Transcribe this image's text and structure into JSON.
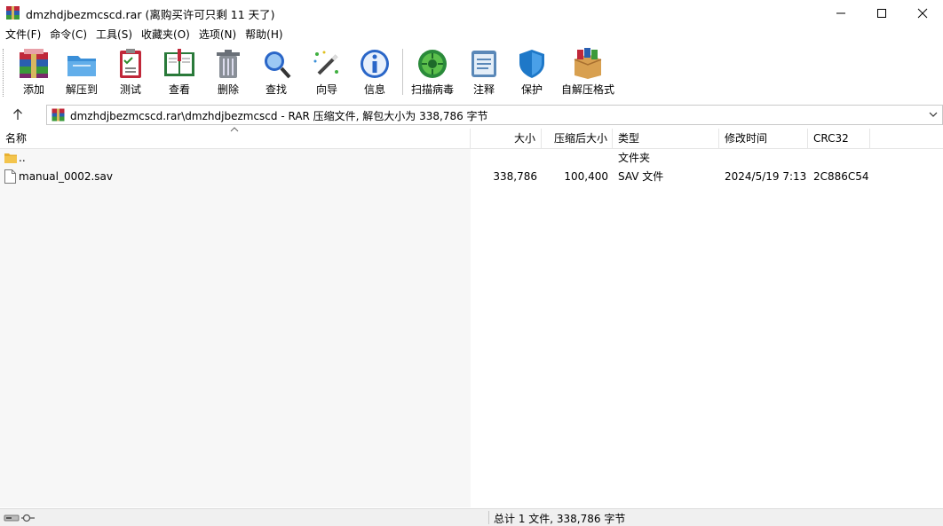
{
  "window": {
    "title": "dmzhdjbezmcscd.rar (离购买许可只剩 11 天了)"
  },
  "menu": {
    "items": [
      "文件(F)",
      "命令(C)",
      "工具(S)",
      "收藏夹(O)",
      "选项(N)",
      "帮助(H)"
    ]
  },
  "toolbar": {
    "add": "添加",
    "extract": "解压到",
    "test": "测试",
    "view": "查看",
    "delete": "删除",
    "find": "查找",
    "wizard": "向导",
    "info": "信息",
    "scan": "扫描病毒",
    "comment": "注释",
    "protect": "保护",
    "sfx": "自解压格式"
  },
  "address": {
    "path": "dmzhdjbezmcscd.rar\\dmzhdjbezmcscd - RAR 压缩文件, 解包大小为 338,786 字节"
  },
  "columns": {
    "name": "名称",
    "size": "大小",
    "packed": "压缩后大小",
    "type": "类型",
    "modified": "修改时间",
    "crc": "CRC32"
  },
  "rows": [
    {
      "name": "..",
      "size": "",
      "packed": "",
      "type": "文件夹",
      "modified": "",
      "crc": ""
    },
    {
      "name": "manual_0002.sav",
      "size": "338,786",
      "packed": "100,400",
      "type": "SAV 文件",
      "modified": "2024/5/19 7:13",
      "crc": "2C886C54"
    }
  ],
  "status": {
    "text": "总计 1 文件, 338,786 字节"
  },
  "colors": {
    "accent_blue": "#1e78c8",
    "rar_red": "#b0242c",
    "folder_yellow": "#f3c44c"
  }
}
